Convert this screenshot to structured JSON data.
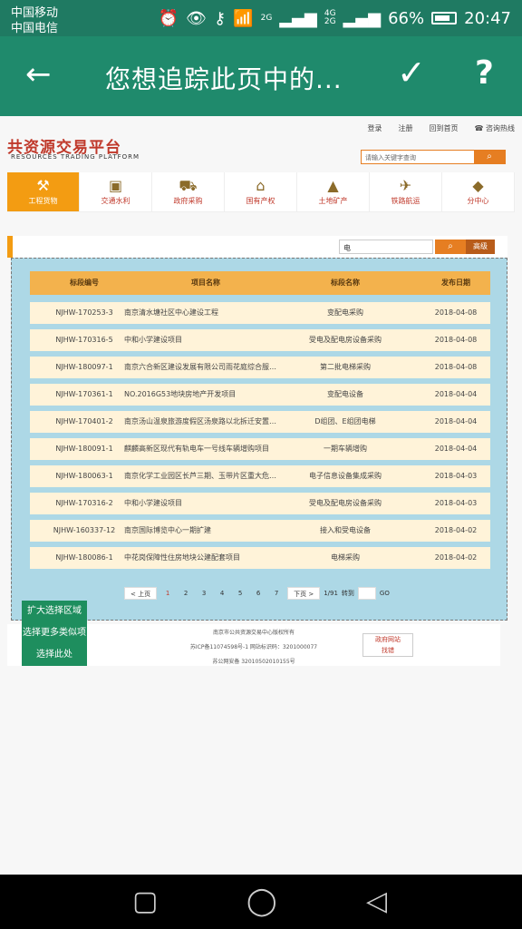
{
  "status": {
    "carrier1": "中国移动",
    "carrier2": "中国电信",
    "signal1": "2G",
    "signal2": "4G\n2G",
    "battery": "66%",
    "time": "20:47"
  },
  "toolbar": {
    "title": "您想追踪此页中的...",
    "back_icon": "arrow-left",
    "confirm_icon": "check",
    "help_icon": "question"
  },
  "site": {
    "top_links": [
      "登录",
      "注册",
      "回到首页",
      "咨询热线"
    ],
    "logo_cn": "共资源交易平台",
    "logo_en": "RESOURCES TRADING PLATFORM",
    "search_placeholder": "请输入关键字查询",
    "menu": [
      "工程货物",
      "交通水利",
      "政府采购",
      "国有产权",
      "土地矿产",
      "铁路航运",
      "分中心"
    ]
  },
  "filter": {
    "input_value": "电",
    "advanced_label": "高级"
  },
  "table": {
    "headers": [
      "标段编号",
      "项目名称",
      "标段名称",
      "发布日期"
    ],
    "rows": [
      {
        "code": "NJHW-170253-3",
        "name": "南京清水塘社区中心建设工程",
        "section": "变配电采购",
        "date": "2018-04-08"
      },
      {
        "code": "NJHW-170316-5",
        "name": "中和小学建设项目",
        "section": "受电及配电房设备采购",
        "date": "2018-04-08"
      },
      {
        "code": "NJHW-180097-1",
        "name": "南京六合新区建设发展有限公司雨花庭综合服…",
        "section": "第二批电梯采购",
        "date": "2018-04-08"
      },
      {
        "code": "NJHW-170361-1",
        "name": "NO.2016G53地块房地产开发项目",
        "section": "变配电设备",
        "date": "2018-04-04"
      },
      {
        "code": "NJHW-170401-2",
        "name": "南京汤山温泉旅游度假区汤泉路以北拆迁安置…",
        "section": "D组团、E组团电梯",
        "date": "2018-04-04"
      },
      {
        "code": "NJHW-180091-1",
        "name": "麒麟高新区现代有轨电车一号线车辆增购项目",
        "section": "一期车辆增购",
        "date": "2018-04-04"
      },
      {
        "code": "NJHW-180063-1",
        "name": "南京化学工业园区长芦三期、玉带片区重大危…",
        "section": "电子信息设备集成采购",
        "date": "2018-04-03"
      },
      {
        "code": "NJHW-170316-2",
        "name": "中和小学建设项目",
        "section": "受电及配电房设备采购",
        "date": "2018-04-03"
      },
      {
        "code": "NJHW-160337-12",
        "name": "南京国际博览中心一期扩建",
        "section": "接入和受电设备",
        "date": "2018-04-02"
      },
      {
        "code": "NJHW-180086-1",
        "name": "中花岗保障性住房地块公建配套项目",
        "section": "电梯采购",
        "date": "2018-04-02"
      }
    ]
  },
  "pager": {
    "prev": "< 上页",
    "pages": [
      "1",
      "2",
      "3",
      "4",
      "5",
      "6",
      "7"
    ],
    "next": "下页 >",
    "info": "1/91",
    "goto_label": "转到",
    "go": "GO"
  },
  "footer": {
    "line1": "南京市公共资源交易中心版权所有",
    "line2": "苏ICP备11074598号-1 网站标识码：3201000077",
    "line3": "苏公网安备 32010502010155号",
    "badge": "政府网站\n找错"
  },
  "float_actions": [
    "扩大选择区域",
    "选择更多类似项",
    "选择此处"
  ]
}
